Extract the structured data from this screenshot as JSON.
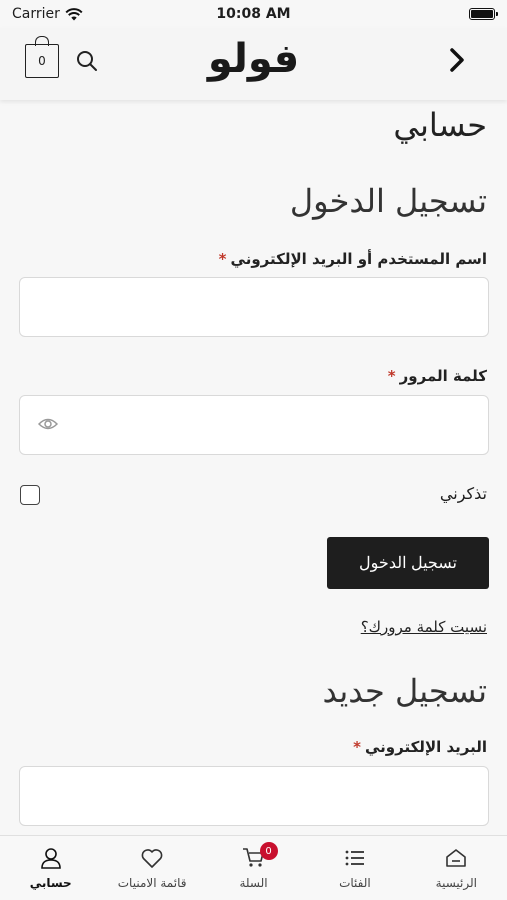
{
  "status_bar": {
    "carrier": "Carrier",
    "time": "10:08 AM"
  },
  "header": {
    "logo": "فولو",
    "cart_count": "0"
  },
  "page": {
    "title": "حسابي",
    "login": {
      "heading": "تسجيل الدخول",
      "username_label": "اسم المستخدم أو البريد الإلكتروني",
      "password_label": "كلمة المرور",
      "required_mark": "*",
      "remember_label": "تذكرني",
      "submit_label": "تسجيل الدخول",
      "forgot_link": "نسيت كلمة مرورك؟"
    },
    "register": {
      "heading": "تسجيل جديد",
      "email_label": "البريد الإلكتروني",
      "required_mark": "*"
    }
  },
  "tabbar": {
    "home": "الرئيسية",
    "categories": "الفئات",
    "cart": "السلة",
    "cart_badge": "0",
    "wishlist": "قائمة الامنيات",
    "account": "حسابي"
  },
  "colors": {
    "accent_dark": "#1e1e1e",
    "badge_red": "#c8102e",
    "required_red": "#c0392b"
  }
}
